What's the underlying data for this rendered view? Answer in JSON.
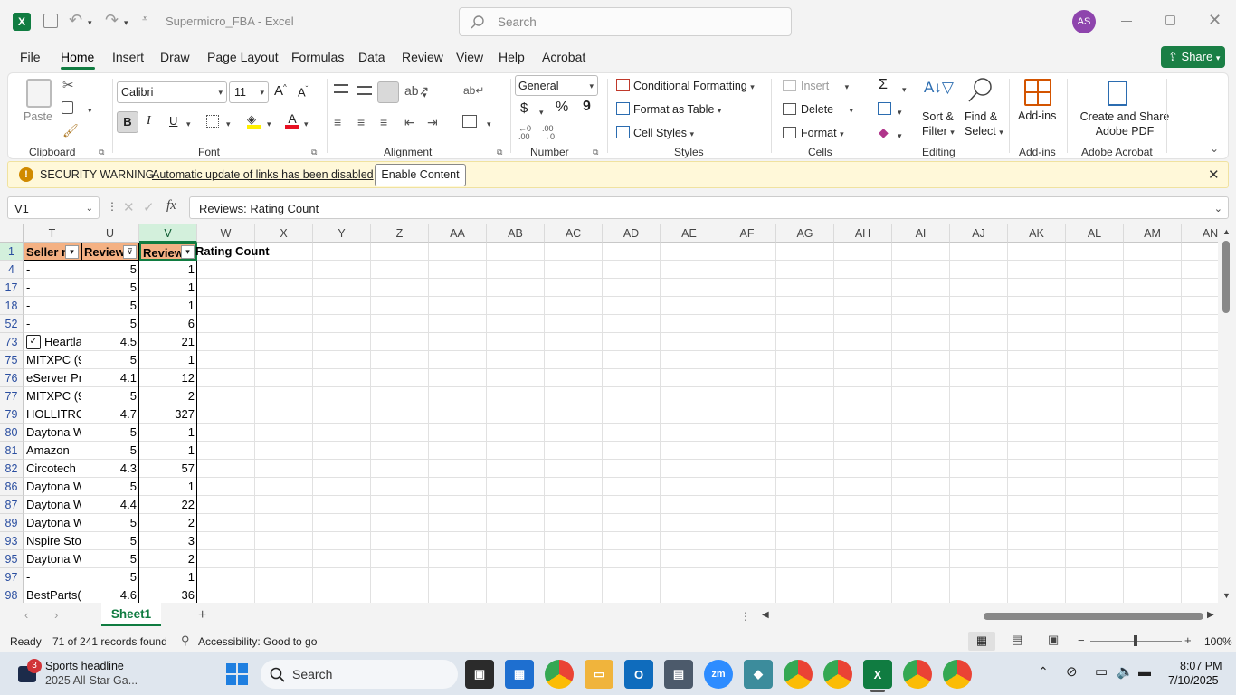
{
  "window": {
    "title": "Supermicro_FBA  -  Excel",
    "search_placeholder": "Search",
    "user_initials": "AS"
  },
  "menu": {
    "items": [
      "File",
      "Home",
      "Insert",
      "Draw",
      "Page Layout",
      "Formulas",
      "Data",
      "Review",
      "View",
      "Help",
      "Acrobat"
    ],
    "active": "Home",
    "share": "Share"
  },
  "ribbon": {
    "clipboard": {
      "paste": "Paste",
      "label": "Clipboard"
    },
    "font": {
      "name": "Calibri",
      "size": "11",
      "label": "Font",
      "bold": "B",
      "italic": "I",
      "underline": "U"
    },
    "alignment": {
      "label": "Alignment"
    },
    "number": {
      "format": "General",
      "label": "Number",
      "currency": "$",
      "percent": "%",
      "comma": "9"
    },
    "styles": {
      "cond": "Conditional Formatting",
      "table": "Format as Table",
      "cell": "Cell Styles",
      "label": "Styles"
    },
    "cells": {
      "insert": "Insert",
      "delete": "Delete",
      "format": "Format",
      "label": "Cells"
    },
    "editing": {
      "sort1": "Sort &",
      "sort2": "Filter",
      "find1": "Find &",
      "find2": "Select",
      "label": "Editing"
    },
    "addins": {
      "btn": "Add-ins",
      "label": "Add-ins"
    },
    "acrobat": {
      "btn1": "Create and Share",
      "btn2": "Adobe PDF",
      "label": "Adobe Acrobat"
    }
  },
  "security": {
    "title": "SECURITY WARNING",
    "message": "Automatic update of links has been disabled",
    "button": "Enable Content"
  },
  "formula": {
    "namebox": "V1",
    "fx": "fx",
    "content": "Reviews: Rating Count"
  },
  "grid": {
    "columns": [
      "T",
      "U",
      "V",
      "W",
      "X",
      "Y",
      "Z",
      "AA",
      "AB",
      "AC",
      "AD",
      "AE",
      "AF",
      "AG",
      "AH",
      "AI",
      "AJ",
      "AK",
      "AL",
      "AM",
      "AN"
    ],
    "header": {
      "t": "Seller n",
      "u": "Review",
      "v": "Review",
      "overflow": "Rating Count"
    },
    "rows": [
      {
        "n": "1",
        "t": "",
        "u": "",
        "v": ""
      },
      {
        "n": "4",
        "t": "-",
        "u": "5",
        "v": "1"
      },
      {
        "n": "17",
        "t": "-",
        "u": "5",
        "v": "1"
      },
      {
        "n": "18",
        "t": "-",
        "u": "5",
        "v": "1"
      },
      {
        "n": "52",
        "t": "-",
        "u": "5",
        "v": "6"
      },
      {
        "n": "73",
        "t": "Heartla",
        "u": "4.5",
        "v": "21"
      },
      {
        "n": "75",
        "t": "MITXPC (9",
        "u": "5",
        "v": "1"
      },
      {
        "n": "76",
        "t": "eServer Pr",
        "u": "4.1",
        "v": "12"
      },
      {
        "n": "77",
        "t": "MITXPC (9",
        "u": "5",
        "v": "2"
      },
      {
        "n": "79",
        "t": "HOLLITRO",
        "u": "4.7",
        "v": "327"
      },
      {
        "n": "80",
        "t": "Daytona W",
        "u": "5",
        "v": "1"
      },
      {
        "n": "81",
        "t": "Amazon",
        "u": "5",
        "v": "1"
      },
      {
        "n": "82",
        "t": "Circotech",
        "u": "4.3",
        "v": "57"
      },
      {
        "n": "86",
        "t": "Daytona W",
        "u": "5",
        "v": "1"
      },
      {
        "n": "87",
        "t": "Daytona W",
        "u": "4.4",
        "v": "22"
      },
      {
        "n": "89",
        "t": "Daytona W",
        "u": "5",
        "v": "2"
      },
      {
        "n": "93",
        "t": "Nspire Sto",
        "u": "5",
        "v": "3"
      },
      {
        "n": "95",
        "t": "Daytona W",
        "u": "5",
        "v": "2"
      },
      {
        "n": "97",
        "t": "-",
        "u": "5",
        "v": "1"
      },
      {
        "n": "98",
        "t": "BestParts(",
        "u": "4.6",
        "v": "36"
      }
    ]
  },
  "sheet": {
    "tab": "Sheet1"
  },
  "status": {
    "ready": "Ready",
    "records": "71 of 241 records found",
    "accessibility": "Accessibility: Good to go",
    "zoom": "100%"
  },
  "taskbar": {
    "news_title": "Sports headline",
    "news_sub": "2025 All-Star Ga...",
    "badge": "3",
    "search": "Search",
    "time": "8:07 PM",
    "date": "7/10/2025"
  }
}
